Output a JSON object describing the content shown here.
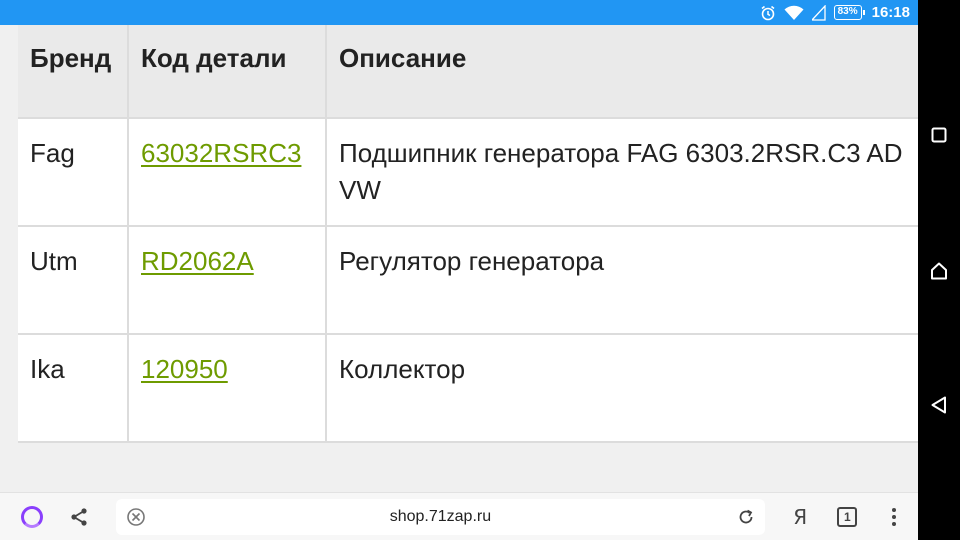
{
  "status_bar": {
    "clock": "16:18",
    "battery": "83%",
    "icons": [
      "alarm-icon",
      "wifi-icon",
      "signal-icon",
      "battery-icon"
    ]
  },
  "table": {
    "headers": [
      "Бренд",
      "Код детали",
      "Описание"
    ],
    "rows": [
      {
        "brand": "Fag",
        "code": "63032RSRC3",
        "description": "Подшипник генератора FAG 6303.2RSR.C3 AD VW"
      },
      {
        "brand": "Utm",
        "code": "RD2062A",
        "description": "Регулятор генератора"
      },
      {
        "brand": "Ika",
        "code": "120950",
        "description": "Коллектор"
      }
    ],
    "link_color": "#6e9b00"
  },
  "browser_bar": {
    "url": "shop.71zap.ru",
    "ya_label": "Я",
    "tab_count": "1",
    "icons": [
      "alice-icon",
      "share-icon",
      "stop-loading-icon",
      "reload-icon",
      "yandex-icon",
      "tabs-icon",
      "menu-icon"
    ]
  },
  "nav_bar": {
    "icons": [
      "recents-icon",
      "home-icon",
      "back-icon"
    ]
  },
  "colors": {
    "status_bar": "#2196f3",
    "header_bg": "#eaeaea",
    "page_bg": "#f0f0f0"
  }
}
